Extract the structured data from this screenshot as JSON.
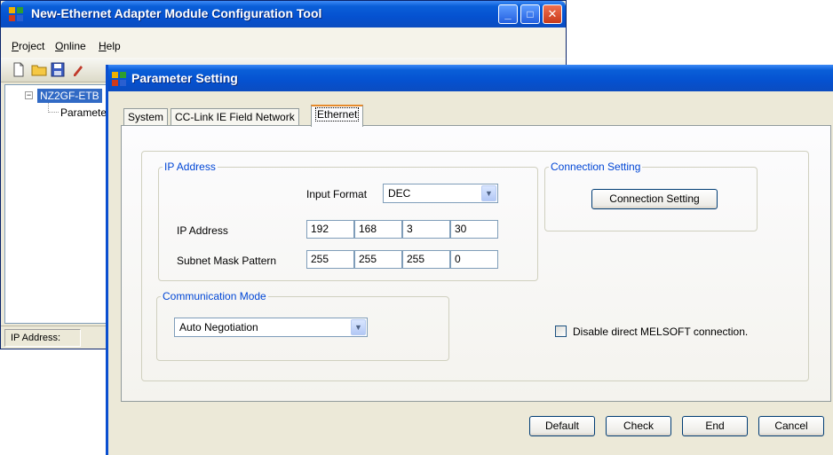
{
  "main_window": {
    "title": "New-Ethernet Adapter Module Configuration Tool",
    "menu": [
      "Project",
      "Online",
      "Help"
    ],
    "tree": {
      "root": "NZ2GF-ETB",
      "child": "Paramete"
    },
    "status_label": "IP Address:",
    "caption_buttons": {
      "minimize": "_",
      "maximize": "□",
      "close": "✕"
    }
  },
  "dialog": {
    "title": "Parameter Setting",
    "tabs": [
      "System",
      "CC-Link IE Field Network",
      "Ethernet"
    ],
    "active_tab": "Ethernet",
    "ip_group": {
      "legend": "IP Address",
      "input_format_label": "Input Format",
      "input_format_value": "DEC",
      "ip_label": "IP Address",
      "ip_octets": [
        "192",
        "168",
        "3",
        "30"
      ],
      "subnet_label": "Subnet Mask Pattern",
      "subnet_octets": [
        "255",
        "255",
        "255",
        "0"
      ]
    },
    "connection_group": {
      "legend": "Connection Setting",
      "button_label": "Connection Setting"
    },
    "comm_group": {
      "legend": "Communication Mode",
      "value": "Auto Negotiation"
    },
    "disable_melsoft": {
      "label": "Disable direct MELSOFT connection.",
      "checked": false
    },
    "buttons": {
      "default": "Default",
      "check": "Check",
      "end": "End",
      "cancel": "Cancel"
    }
  }
}
